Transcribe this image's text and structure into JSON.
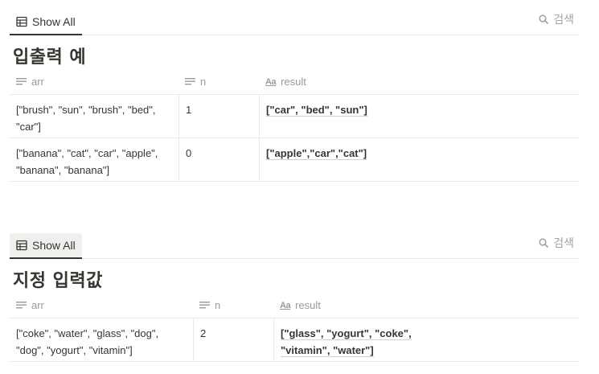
{
  "icons": {
    "table": "table-icon",
    "search": "search-icon",
    "text_prop": "text-lines-icon",
    "title_prop": "aa-icon"
  },
  "section1": {
    "view_label": "Show All",
    "search_label": "검색",
    "heading": "입출력 예",
    "columns": {
      "arr": "arr",
      "n": "n",
      "result": "result",
      "result_icon": "Aa"
    },
    "rows": [
      {
        "arr": "[\"brush\", \"sun\", \"brush\", \"bed\", \"car\"]",
        "n": "1",
        "result": "[\"car\", \"bed\", \"sun\"]"
      },
      {
        "arr": "[\"banana\", \"cat\", \"car\", \"apple\", \"banana\", \"banana\"]",
        "n": "0",
        "result": "[\"apple\",\"car\",\"cat\"]"
      }
    ]
  },
  "section2": {
    "view_label": "Show All",
    "search_label": "검색",
    "heading": "지정 입력값",
    "columns": {
      "arr": "arr",
      "n": "n",
      "result": "result",
      "result_icon": "Aa"
    },
    "rows": [
      {
        "arr": "[\"coke\", \"water\", \"glass\", \"dog\", \"dog\", \"yogurt\", \"vitamin\"]",
        "n": "2",
        "result": "[\"glass\", \"yogurt\", \"coke\", \"vitamin\", \"water\"]"
      }
    ]
  }
}
